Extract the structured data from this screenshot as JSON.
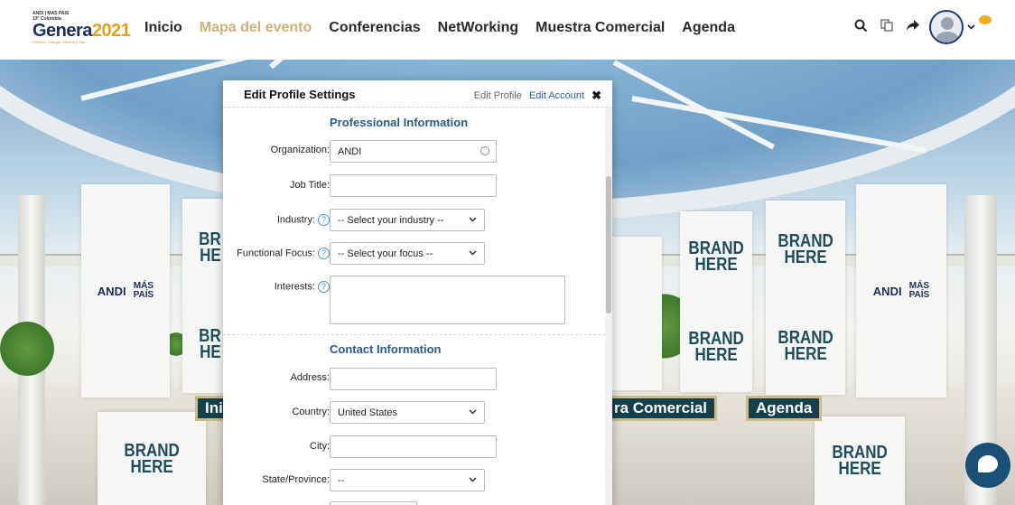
{
  "nav": {
    "logo_small": "ANDI | MAS PAIS",
    "logo_edition": "13° Colombia",
    "logo_word": "Genera",
    "logo_year": "2021",
    "logo_tag": "Petróleo, Energía, Minería y Gas",
    "links": [
      "Inicio",
      "Mapa del evento",
      "Conferencias",
      "NetWorking",
      "Muestra Comercial",
      "Agenda"
    ],
    "active_index": 1
  },
  "scene": {
    "banner_text_line1": "BRAND",
    "banner_text_line2": "HERE",
    "andi_text": "ANDI",
    "maspais_line1": "MÁS",
    "maspais_line2": "PAÍS",
    "partial_brand_1": "BR",
    "partial_brand_2": "HE",
    "sign_left": "Ini",
    "sign_middle": "ra Comercial",
    "sign_right": "Agenda"
  },
  "modal": {
    "title": "Edit Profile Settings",
    "link_edit_profile": "Edit Profile",
    "link_edit_account": "Edit Account",
    "close_symbol": "✖",
    "professional": {
      "title": "Professional Information",
      "organization_label": "Organization:",
      "organization_value": "ANDI",
      "job_title_label": "Job Title:",
      "job_title_value": "",
      "industry_label": "Industry:",
      "industry_value": "-- Select your industry --",
      "focus_label": "Functional Focus:",
      "focus_value": "-- Select your focus --",
      "interests_label": "Interests:",
      "interests_value": ""
    },
    "contact": {
      "title": "Contact Information",
      "address_label": "Address:",
      "address_value": "",
      "country_label": "Country:",
      "country_value": "United States",
      "city_label": "City:",
      "city_value": "",
      "state_label": "State/Province:",
      "state_value": "--"
    },
    "help_glyph": "?"
  },
  "colors": {
    "accent": "#2c5a8c",
    "nav_active": "#cdb07a",
    "sign_bg": "#15404b",
    "chat_fab": "#1a4f76"
  }
}
